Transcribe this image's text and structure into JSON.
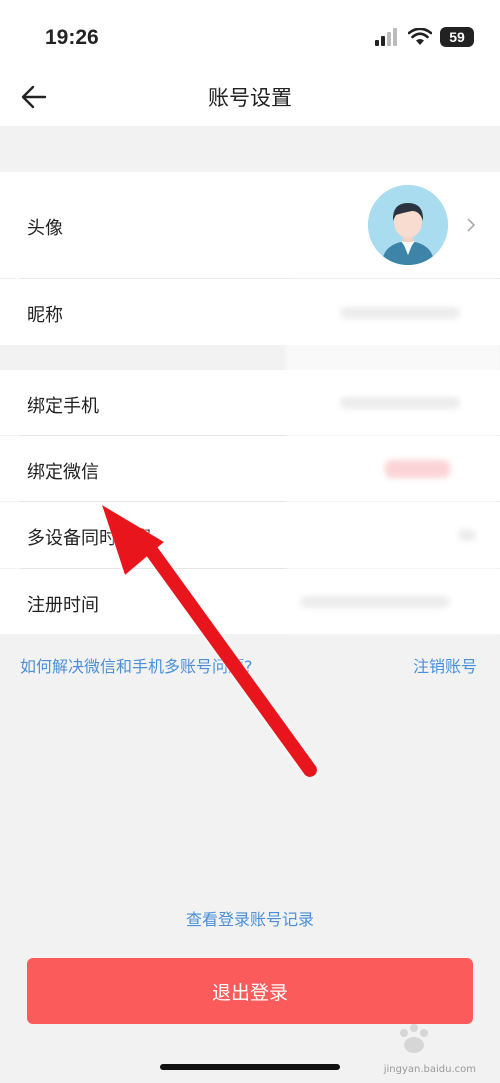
{
  "status_bar": {
    "time": "19:26",
    "battery": "59"
  },
  "header": {
    "title": "账号设置"
  },
  "rows": [
    {
      "label": "头像"
    },
    {
      "label": "昵称"
    },
    {
      "label": "绑定手机"
    },
    {
      "label": "绑定微信"
    },
    {
      "label": "多设备同时登录"
    },
    {
      "label": "注册时间"
    }
  ],
  "links": {
    "help": "如何解决微信和手机多账号问题?",
    "cancel_account": "注销账号",
    "login_records": "查看登录账号记录"
  },
  "buttons": {
    "logout": "退出登录"
  },
  "watermark": {
    "text": "Bai 经验",
    "sub": "jingyan.baidu.com"
  },
  "colors": {
    "accent": "#4a90d9",
    "logout": "#fc5b5b",
    "arrow": "#e8161c"
  }
}
